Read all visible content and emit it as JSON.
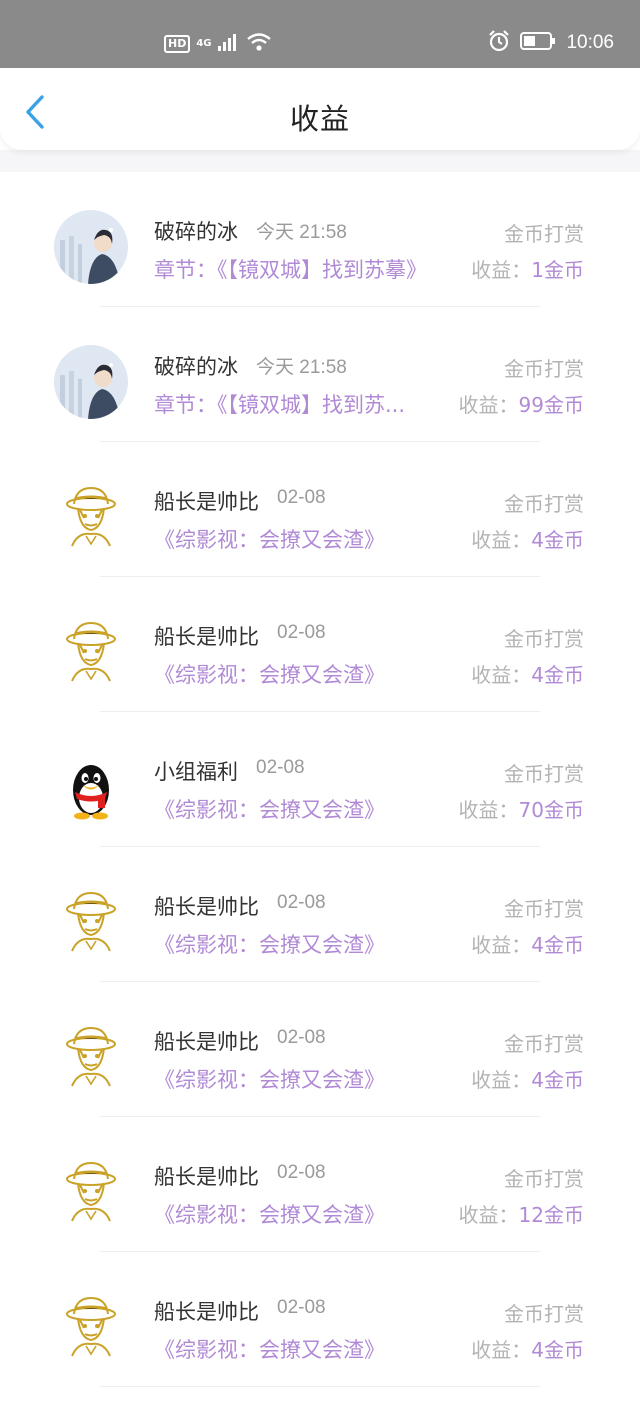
{
  "status_bar": {
    "hd": "HD",
    "network": "4G",
    "time": "10:06",
    "icons": [
      "signal-icon",
      "wifi-icon",
      "alarm-icon",
      "battery-icon"
    ]
  },
  "header": {
    "title": "收益",
    "back_icon": "chevron-left-icon"
  },
  "colors": {
    "accent": "#b18ad6",
    "back": "#3aa0e8",
    "muted": "#b3b3b3"
  },
  "income_label": "收益：",
  "records": [
    {
      "name": "破碎的冰",
      "time": "今天 21:58",
      "type": "金币打赏",
      "chapter": "章节：《【镜双城】找到苏摹》",
      "income": "1金币",
      "avatar": "portrait"
    },
    {
      "name": "破碎的冰",
      "time": "今天 21:58",
      "type": "金币打赏",
      "chapter": "章节：《【镜双城】找到苏...",
      "income": "99金币",
      "avatar": "portrait"
    },
    {
      "name": "船长是帅比",
      "time": "02-08",
      "type": "金币打赏",
      "chapter": "《综影视：会撩又会渣》",
      "income": "4金币",
      "avatar": "straw-hat"
    },
    {
      "name": "船长是帅比",
      "time": "02-08",
      "type": "金币打赏",
      "chapter": "《综影视：会撩又会渣》",
      "income": "4金币",
      "avatar": "straw-hat"
    },
    {
      "name": "小组福利",
      "time": "02-08",
      "type": "金币打赏",
      "chapter": "《综影视：会撩又会渣》",
      "income": "70金币",
      "avatar": "penguin"
    },
    {
      "name": "船长是帅比",
      "time": "02-08",
      "type": "金币打赏",
      "chapter": "《综影视：会撩又会渣》",
      "income": "4金币",
      "avatar": "straw-hat"
    },
    {
      "name": "船长是帅比",
      "time": "02-08",
      "type": "金币打赏",
      "chapter": "《综影视：会撩又会渣》",
      "income": "4金币",
      "avatar": "straw-hat"
    },
    {
      "name": "船长是帅比",
      "time": "02-08",
      "type": "金币打赏",
      "chapter": "《综影视：会撩又会渣》",
      "income": "12金币",
      "avatar": "straw-hat"
    },
    {
      "name": "船长是帅比",
      "time": "02-08",
      "type": "金币打赏",
      "chapter": "《综影视：会撩又会渣》",
      "income": "4金币",
      "avatar": "straw-hat"
    }
  ]
}
